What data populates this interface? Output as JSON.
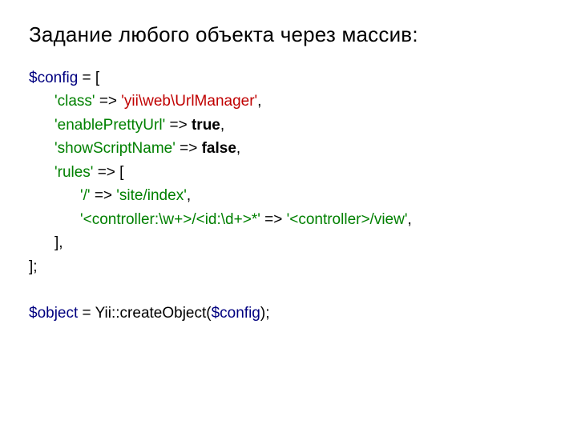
{
  "title": "Задание любого объекта через массив:",
  "code": {
    "l1": {
      "var": "$config",
      "eq": " = [",
      "open": "["
    },
    "l2": {
      "key": "'class'",
      "arrow": " => ",
      "val": "'yii\\web\\UrlManager'",
      "comma": ","
    },
    "l3": {
      "key": "'enablePrettyUrl'",
      "arrow": " => ",
      "val": "true",
      "comma": ","
    },
    "l4": {
      "key": "'showScriptName'",
      "arrow": " => ",
      "val": "false",
      "comma": ","
    },
    "l5": {
      "key": "'rules'",
      "arrow": " => [",
      "open": "["
    },
    "l6": {
      "key": "'/'",
      "arrow": " => ",
      "val": "'site/index'",
      "comma": ","
    },
    "l7": {
      "key": "'<controller:\\w+>/<id:\\d+>*'",
      "arrow": " => ",
      "val": "'<controller>/view'",
      "comma": ","
    },
    "l8": {
      "close": "],"
    },
    "l9": {
      "close": "];"
    },
    "l10": {
      "var": "$object",
      "eq": " = Yii::createObject(",
      "arg": "$config",
      "end": ");"
    }
  }
}
